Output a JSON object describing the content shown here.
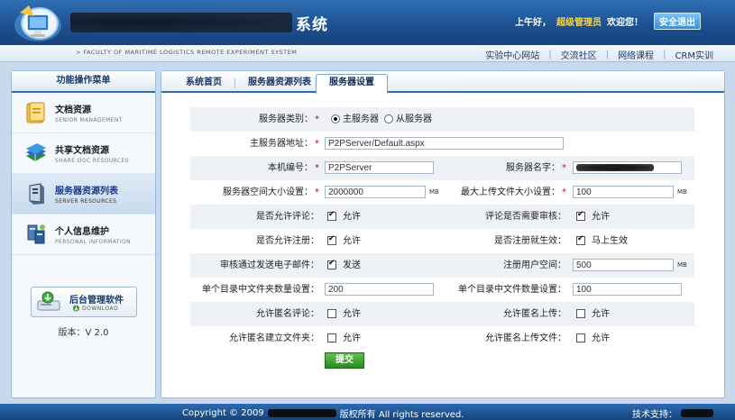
{
  "header": {
    "system_title": "系统",
    "greeting": "上午好，",
    "user_name": "超级管理员",
    "welcome": "欢迎您！",
    "logout_label": "安全退出",
    "subtitle": "> FACULTY OF MARITIME LOGISTICS REMOTE EXPERIMENT SYSTEM",
    "links": [
      "实验中心网站",
      "交流社区",
      "网络课程",
      "CRM实训"
    ]
  },
  "sidebar": {
    "title": "功能操作菜单",
    "items": [
      {
        "label": "文档资源",
        "sub": "SENIOR MANAGEMENT",
        "icon": "folder-icon"
      },
      {
        "label": "共享文档资源",
        "sub": "SHARE DOC RESOURCES",
        "icon": "books-icon"
      },
      {
        "label": "服务器资源列表",
        "sub": "SERVER RESOURCES",
        "icon": "server-icon"
      },
      {
        "label": "个人信息维护",
        "sub": "PERSONAL INFORMATION",
        "icon": "network-icon"
      }
    ],
    "download": {
      "label": "后台管理软件",
      "sub": "DOWNLOAD"
    },
    "version": "版本：V 2.0"
  },
  "tabs": [
    "系统首页",
    "服务器资源列表",
    "服务器设置"
  ],
  "form": {
    "server_type_label": "服务器类别：",
    "server_type_options": [
      "主服务器",
      "从服务器"
    ],
    "server_address_label": "主服务器地址：",
    "server_address_value": "P2PServer/Default.aspx",
    "local_id_label": "本机编号：",
    "local_id_value": "P2PServer",
    "server_name_label": "服务器名字：",
    "space_label": "服务器空间大小设置：",
    "space_value": "2000000",
    "space_unit": "MB",
    "max_upload_label": "最大上传文件大小设置：",
    "max_upload_value": "100",
    "max_upload_unit": "MB",
    "allow_comment_label": "是否允许评论：",
    "allow_comment_text": "允许",
    "comment_review_label": "评论是否需要审核：",
    "comment_review_text": "允许",
    "allow_register_label": "是否允许注册：",
    "allow_register_text": "允许",
    "register_effective_label": "是否注册就生效：",
    "register_effective_text": "马上生效",
    "email_label": "审核通过发送电子邮件：",
    "email_text": "发送",
    "user_space_label": "注册用户空间：",
    "user_space_value": "500",
    "user_space_unit": "MB",
    "folder_count_label": "单个目录中文件夹数量设置：",
    "folder_count_value": "200",
    "file_count_label": "单个目录中文件数量设置：",
    "file_count_value": "100",
    "anon_comment_label": "允许匿名评论：",
    "anon_comment_text": "允许",
    "anon_upload_label": "允许匿名上传：",
    "anon_upload_text": "允许",
    "anon_folder_label": "允许匿名建立文件夹：",
    "anon_folder_text": "允许",
    "anon_upload_file_label": "允许匿名上传文件：",
    "anon_upload_file_text": "允许",
    "submit_label": "提交"
  },
  "footer": {
    "copyright_prefix": "Copyright © 2009",
    "copyright_suffix": "版权所有  All rights reserved.",
    "support_label": "技术支持："
  }
}
